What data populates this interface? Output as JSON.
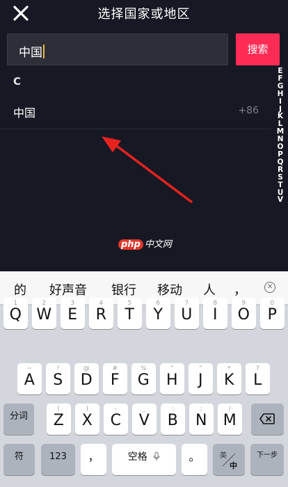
{
  "header": {
    "title": "选择国家或地区",
    "close_icon": "close-icon"
  },
  "search": {
    "value": "中国",
    "button_label": "搜索",
    "accent": "#fe2c55"
  },
  "section": {
    "letter": "C"
  },
  "countries": [
    {
      "name": "中国",
      "code": "+86"
    }
  ],
  "index_letters": [
    "E",
    "F",
    "G",
    "H",
    "I",
    "J",
    "K",
    "L",
    "M",
    "N",
    "O",
    "P",
    "Q",
    "R",
    "S",
    "T",
    "U",
    "V"
  ],
  "watermark": {
    "logo": "php",
    "text": "中文网"
  },
  "keyboard": {
    "suggestions": [
      "的",
      "好声音",
      "银行",
      "移动",
      "人",
      "，"
    ],
    "suggest_delete_icon": "close-circle-icon",
    "row1": [
      {
        "main": "Q",
        "sub": "1"
      },
      {
        "main": "W",
        "sub": "2"
      },
      {
        "main": "E",
        "sub": "3"
      },
      {
        "main": "R",
        "sub": "4"
      },
      {
        "main": "T",
        "sub": "5"
      },
      {
        "main": "Y",
        "sub": "6"
      },
      {
        "main": "U",
        "sub": "7"
      },
      {
        "main": "I",
        "sub": "8"
      },
      {
        "main": "O",
        "sub": "9"
      },
      {
        "main": "P",
        "sub": "0"
      }
    ],
    "row2": [
      {
        "main": "A",
        "sub": "~"
      },
      {
        "main": "S",
        "sub": "!"
      },
      {
        "main": "D",
        "sub": "@"
      },
      {
        "main": "F",
        "sub": "#"
      },
      {
        "main": "G",
        "sub": "%"
      },
      {
        "main": "H",
        "sub": "“"
      },
      {
        "main": "J",
        "sub": "”"
      },
      {
        "main": "K",
        "sub": "*"
      },
      {
        "main": "L",
        "sub": "?"
      }
    ],
    "row3": [
      {
        "main": "Z",
        "sub": "("
      },
      {
        "main": "X",
        "sub": ")"
      },
      {
        "main": "C",
        "sub": "-"
      },
      {
        "main": "V",
        "sub": "_"
      },
      {
        "main": "B",
        "sub": ":"
      },
      {
        "main": "N",
        "sub": ";"
      },
      {
        "main": "M",
        "sub": "/"
      }
    ],
    "fenci": "分词",
    "backspace_icon": "backspace-icon",
    "fu": "符",
    "num": "123",
    "comma": "，",
    "space": "空格",
    "mic_icon": "microphone-icon",
    "period": "。",
    "lang_top": "英",
    "lang_bottom": "中",
    "next": "下一步"
  }
}
